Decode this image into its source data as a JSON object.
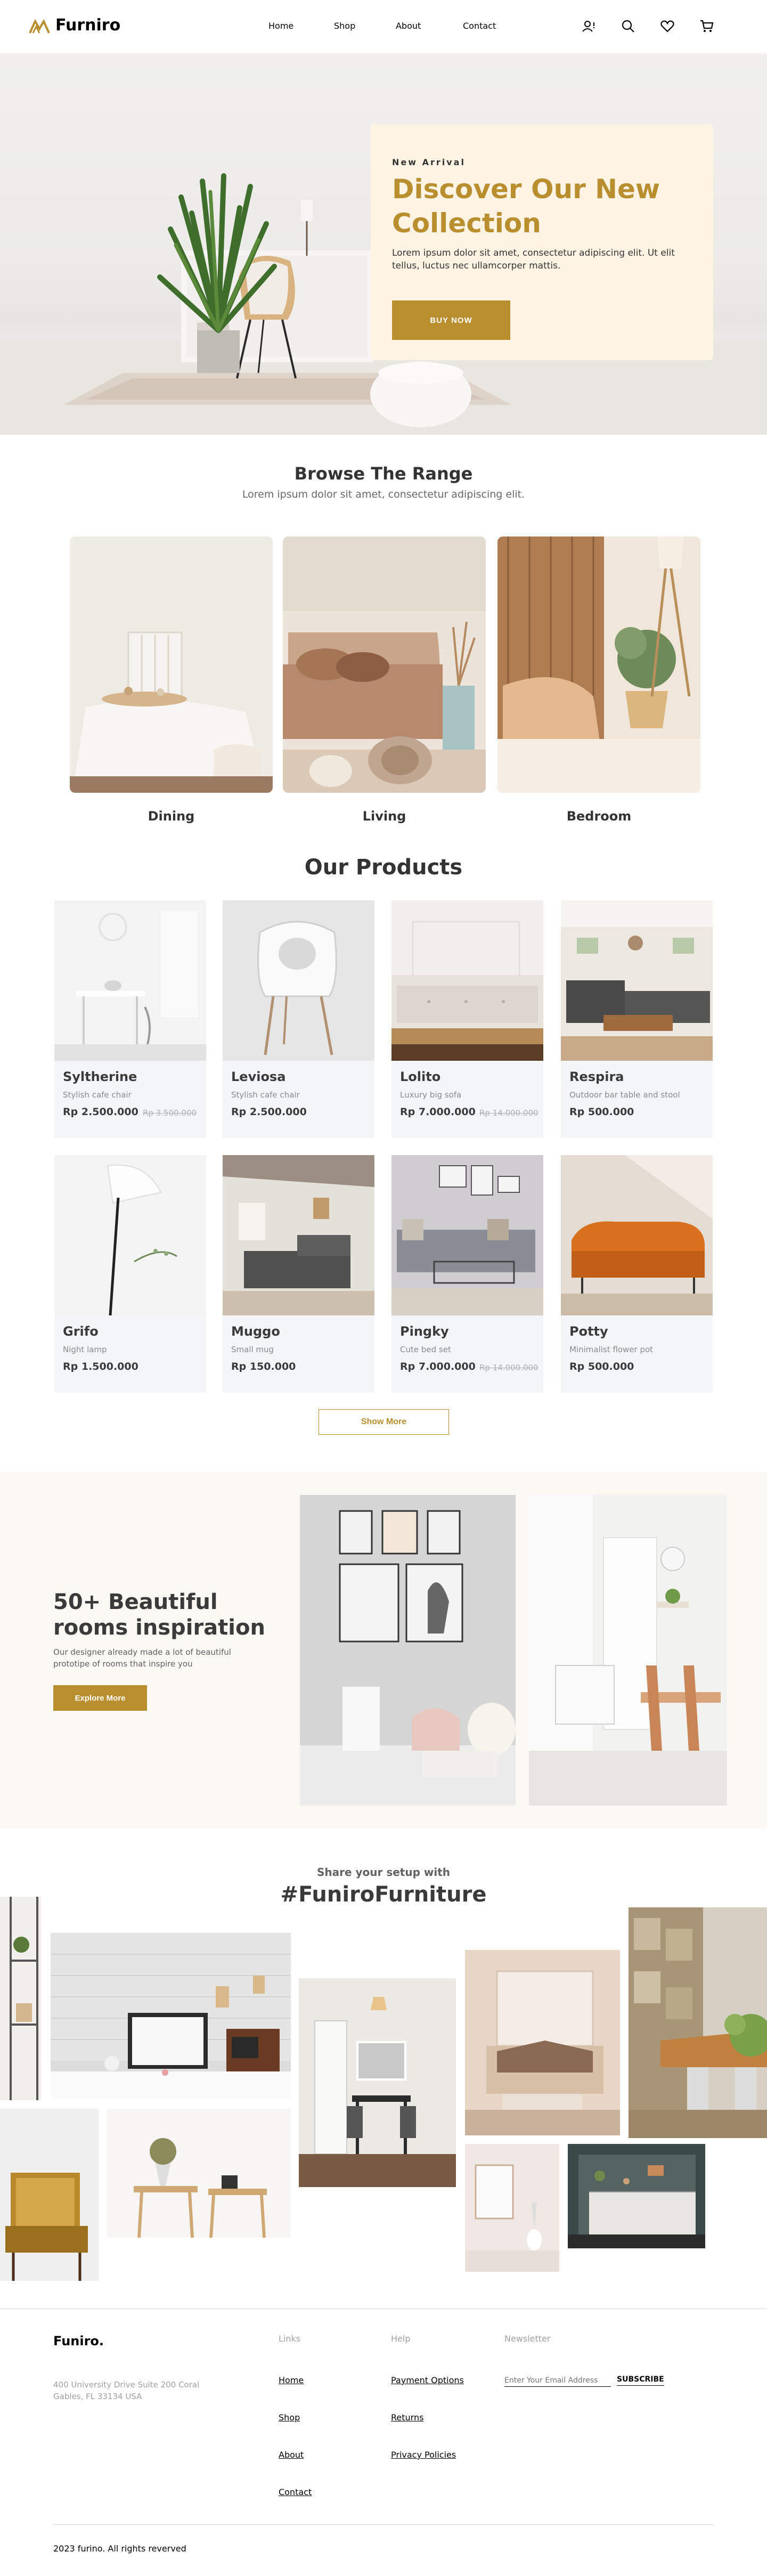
{
  "header": {
    "logo": "Furniro",
    "nav": [
      "Home",
      "Shop",
      "About",
      "Contact"
    ],
    "icons": [
      "account-alert-icon",
      "search-icon",
      "heart-icon",
      "cart-icon"
    ]
  },
  "hero": {
    "kicker": "New Arrival",
    "title": "Discover Our New Collection",
    "description": "Lorem ipsum dolor sit amet, consectetur adipiscing elit. Ut elit tellus, luctus nec ullamcorper mattis.",
    "button": "BUY Now"
  },
  "range": {
    "title": "Browse The Range",
    "subtitle": "Lorem ipsum dolor sit amet, consectetur adipiscing elit.",
    "items": [
      "Dining",
      "Living",
      "Bedroom"
    ]
  },
  "products": {
    "title": "Our Products",
    "items": [
      {
        "name": "Syltherine",
        "desc": "Stylish cafe chair",
        "price": "Rp 2.500.000",
        "old": "Rp 3.500.000"
      },
      {
        "name": "Leviosa",
        "desc": "Stylish cafe chair",
        "price": "Rp 2.500.000",
        "old": ""
      },
      {
        "name": "Lolito",
        "desc": "Luxury big sofa",
        "price": "Rp 7.000.000",
        "old": "Rp 14.000.000"
      },
      {
        "name": "Respira",
        "desc": "Outdoor bar table and stool",
        "price": "Rp 500.000",
        "old": ""
      },
      {
        "name": "Grifo",
        "desc": "Night lamp",
        "price": "Rp 1.500.000",
        "old": ""
      },
      {
        "name": "Muggo",
        "desc": "Small mug",
        "price": "Rp 150.000",
        "old": ""
      },
      {
        "name": "Pingky",
        "desc": "Cute bed set",
        "price": "Rp 7.000.000",
        "old": "Rp 14.000.000"
      },
      {
        "name": "Potty",
        "desc": "Minimalist flower pot",
        "price": "Rp 500.000",
        "old": ""
      }
    ],
    "show_more": "Show More"
  },
  "rooms": {
    "title": "50+ Beautiful rooms inspiration",
    "description": "Our designer already made a lot of beautiful prototipe of rooms that inspire you",
    "button": "Explore More"
  },
  "share": {
    "subtitle": "Share your setup with",
    "title": "#FuniroFurniture"
  },
  "footer": {
    "logo": "Funiro.",
    "address": "400 University Drive Suite 200 Coral Gables, FL 33134 USA",
    "links_head": "Links",
    "links": [
      "Home",
      "Shop",
      "About",
      "Contact"
    ],
    "help_head": "Help",
    "help": [
      "Payment Options",
      "Returns",
      "Privacy Policies"
    ],
    "newsletter_head": "Newsletter",
    "newsletter_placeholder": "Enter Your Email Address",
    "subscribe": "SUBSCRIBE",
    "copyright": "2023 furino. All rights reverved"
  },
  "colors": {
    "accent": "#b88e2f",
    "hero_card": "#fff3e3",
    "rooms_bg": "#fcf8f3",
    "card_bg": "#f4f5f7"
  }
}
